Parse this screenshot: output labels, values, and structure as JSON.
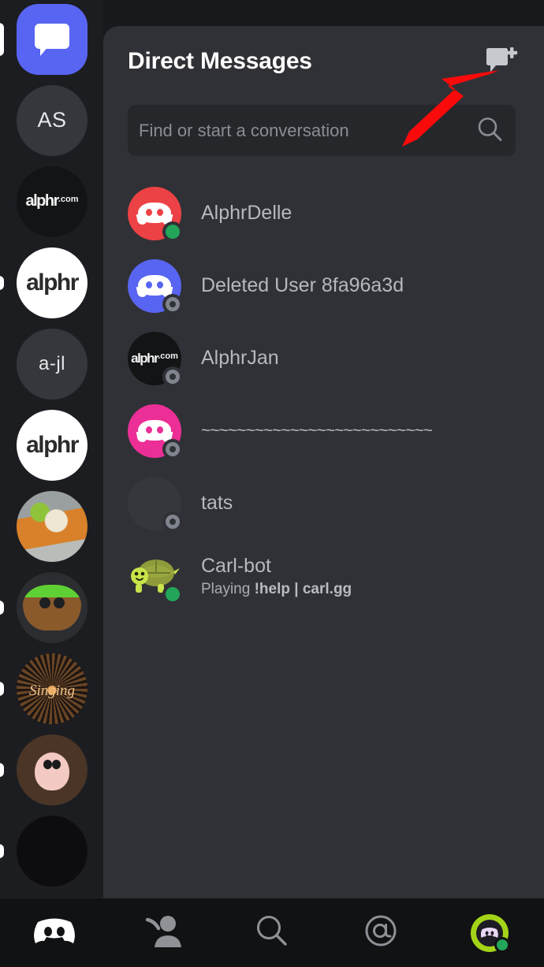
{
  "app": {
    "name": "Discord",
    "screen": "Direct Messages"
  },
  "colors": {
    "brand": "#5865f2",
    "panel_bg": "#303136",
    "rail_bg": "#1c1d21",
    "nav_bg": "#111214",
    "search_bg": "#26272b",
    "online": "#23a559",
    "offline": "#80848e",
    "annotation": "#fa0a0a"
  },
  "header": {
    "title": "Direct Messages",
    "new_dm_icon": "new-message-icon"
  },
  "search": {
    "placeholder": "Find or start a conversation",
    "value": "",
    "icon": "search-icon"
  },
  "server_rail": {
    "items": [
      {
        "name": "direct-messages",
        "label": "",
        "kind": "dm-home",
        "unread": false,
        "selected": true
      },
      {
        "name": "server-as",
        "label": "AS",
        "kind": "initials",
        "unread": false,
        "selected": false
      },
      {
        "name": "server-alphr-com",
        "label": "alphr",
        "suffix": ".com",
        "kind": "alphr-dark",
        "unread": false,
        "selected": false
      },
      {
        "name": "server-alphr-1",
        "label": "alphr",
        "kind": "alphr-white",
        "unread": true,
        "selected": false
      },
      {
        "name": "server-a-jl",
        "label": "a-jl",
        "kind": "initials",
        "unread": false,
        "selected": false
      },
      {
        "name": "server-alphr-2",
        "label": "alphr",
        "kind": "alphr-white",
        "unread": false,
        "selected": false
      },
      {
        "name": "server-shiba",
        "label": "",
        "kind": "photo-shiba",
        "unread": false,
        "selected": false
      },
      {
        "name": "server-minecraft",
        "label": "",
        "kind": "photo-minecraft",
        "unread": true,
        "selected": false
      },
      {
        "name": "server-singing",
        "label": "Singing",
        "kind": "photo-fireworks",
        "unread": true,
        "selected": false
      },
      {
        "name": "server-isaac",
        "label": "",
        "kind": "photo-isaac",
        "unread": true,
        "selected": false
      },
      {
        "name": "server-dark",
        "label": "",
        "kind": "photo-dark",
        "unread": false,
        "selected": false
      }
    ]
  },
  "dm_list": {
    "items": [
      {
        "name": "AlphrDelle",
        "subtitle": "",
        "status": "online",
        "avatar": "clyde-red"
      },
      {
        "name": "Deleted User 8fa96a3d",
        "subtitle": "",
        "status": "offline",
        "avatar": "clyde-blurple"
      },
      {
        "name": "AlphrJan",
        "subtitle": "",
        "status": "offline",
        "avatar": "alphr-logo"
      },
      {
        "name": "~~~~~~~~~~~~~~~~~~~~~~~~~~",
        "subtitle": "",
        "status": "offline",
        "avatar": "clyde-pink"
      },
      {
        "name": "tats",
        "subtitle": "",
        "status": "offline",
        "avatar": "photo-person"
      },
      {
        "name": "Carl-bot",
        "subtitle_prefix": "Playing ",
        "subtitle_bold": "!help | carl.gg",
        "status": "online",
        "avatar": "turtle"
      }
    ]
  },
  "bottom_nav": {
    "items": [
      {
        "name": "nav-servers",
        "icon": "discord-logo-icon",
        "active": true
      },
      {
        "name": "nav-friends",
        "icon": "friends-icon",
        "active": false
      },
      {
        "name": "nav-search",
        "icon": "search-icon",
        "active": false
      },
      {
        "name": "nav-mentions",
        "icon": "at-mention-icon",
        "active": false
      },
      {
        "name": "nav-profile",
        "icon": "user-avatar-icon",
        "active": false
      }
    ]
  },
  "annotation": {
    "type": "arrow",
    "direction": "up-right",
    "target": "new-message-icon"
  }
}
